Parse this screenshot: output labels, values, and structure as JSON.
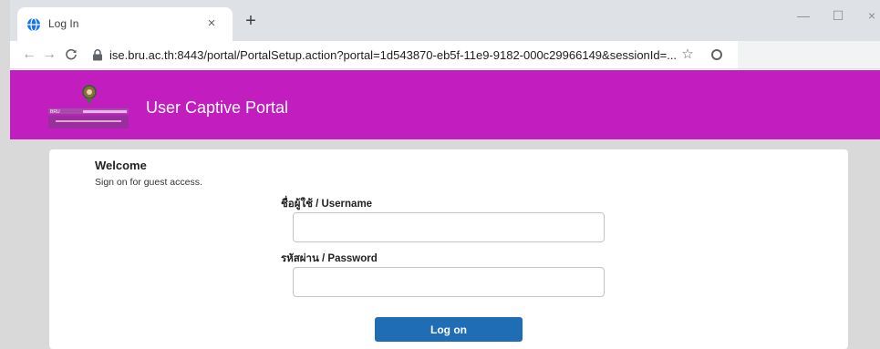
{
  "browser": {
    "tab_title": "Log In",
    "tab_close": "×",
    "new_tab": "+",
    "window_controls": {
      "minimize": "—",
      "maximize": "☐",
      "close": "×"
    },
    "nav": {
      "back": "←",
      "forward": "→",
      "reload": "C"
    },
    "url": "ise.bru.ac.th:8443/portal/PortalSetup.action?portal=1d543870-eb5f-11e9-9182-000c29966149&sessionId=...",
    "bookmark_star": "☆",
    "icons": [
      "globe-favicon-icon",
      "lock-icon",
      "star-icon",
      "extension-icon"
    ]
  },
  "header": {
    "title": "User Captive Portal",
    "logo_text": "BRU",
    "background_color": "#c21dbf"
  },
  "login": {
    "welcome": "Welcome",
    "subtitle": "Sign on for guest access.",
    "username_label": "ชื่อผู้ใช้ / Username",
    "username_value": "",
    "password_label": "รหัสผ่าน / Password",
    "password_value": "",
    "button_label": "Log on",
    "button_color": "#1f6db5"
  }
}
